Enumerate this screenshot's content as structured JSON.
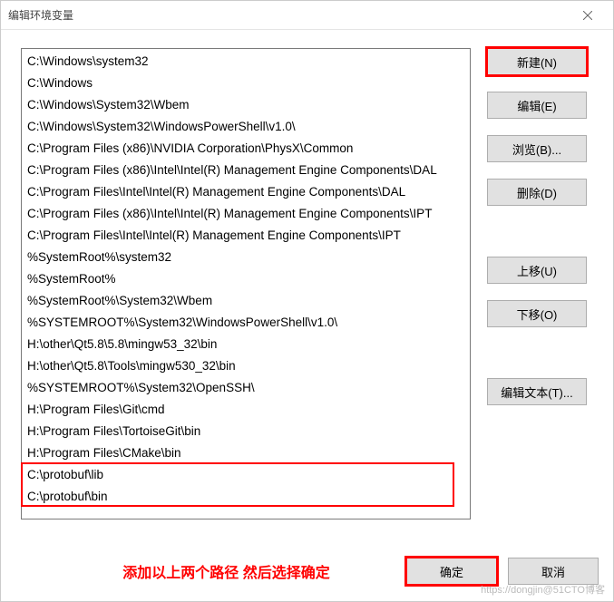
{
  "window": {
    "title": "编辑环境变量"
  },
  "list": {
    "items": [
      "C:\\Windows\\system32",
      "C:\\Windows",
      "C:\\Windows\\System32\\Wbem",
      "C:\\Windows\\System32\\WindowsPowerShell\\v1.0\\",
      "C:\\Program Files (x86)\\NVIDIA Corporation\\PhysX\\Common",
      "C:\\Program Files (x86)\\Intel\\Intel(R) Management Engine Components\\DAL",
      "C:\\Program Files\\Intel\\Intel(R) Management Engine Components\\DAL",
      "C:\\Program Files (x86)\\Intel\\Intel(R) Management Engine Components\\IPT",
      "C:\\Program Files\\Intel\\Intel(R) Management Engine Components\\IPT",
      "%SystemRoot%\\system32",
      "%SystemRoot%",
      "%SystemRoot%\\System32\\Wbem",
      "%SYSTEMROOT%\\System32\\WindowsPowerShell\\v1.0\\",
      "H:\\other\\Qt5.8\\5.8\\mingw53_32\\bin",
      "H:\\other\\Qt5.8\\Tools\\mingw530_32\\bin",
      "%SYSTEMROOT%\\System32\\OpenSSH\\",
      "H:\\Program Files\\Git\\cmd",
      "H:\\Program Files\\TortoiseGit\\bin",
      "H:\\Program Files\\CMake\\bin",
      "C:\\protobuf\\lib",
      "C:\\protobuf\\bin"
    ]
  },
  "buttons": {
    "new": "新建(N)",
    "edit": "编辑(E)",
    "browse": "浏览(B)...",
    "delete": "删除(D)",
    "moveup": "上移(U)",
    "movedown": "下移(O)",
    "edittext": "编辑文本(T)...",
    "ok": "确定",
    "cancel": "取消"
  },
  "note": "添加以上两个路径 然后选择确定",
  "watermark": "https://dongjin@51CTO博客"
}
